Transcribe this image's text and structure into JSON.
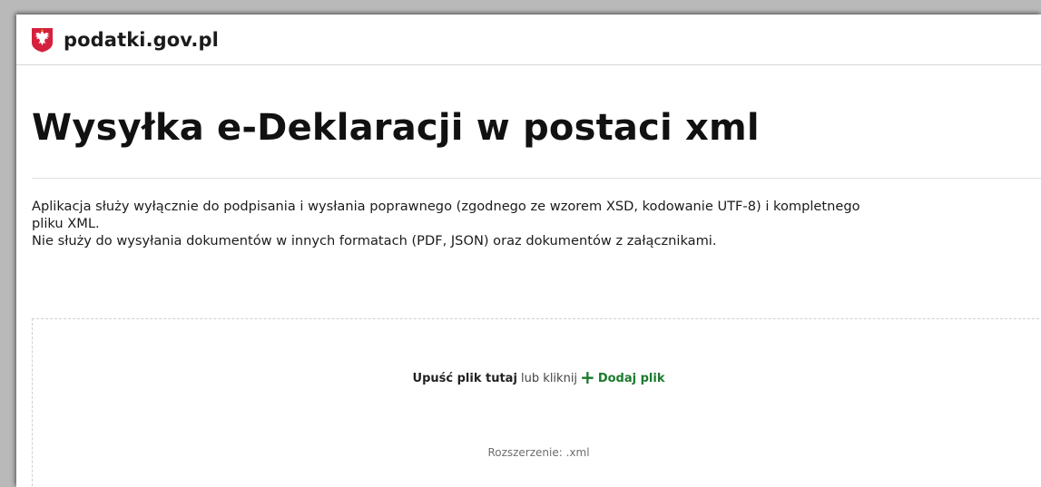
{
  "header": {
    "brand": "podatki.gov.pl",
    "logo_icon": "polish-eagle-emblem-icon",
    "brand_color": "#d4213d"
  },
  "main": {
    "title": "Wysyłka e-Deklaracji w postaci xml",
    "description_lines": [
      "Aplikacja służy wyłącznie do podpisania i wysłania poprawnego (zgodnego ze wzorem XSD, kodowanie UTF-8) i kompletnego",
      "pliku XML.",
      "Nie służy do wysyłania dokumentów w innych formatach (PDF, JSON) oraz dokumentów z załącznikami."
    ]
  },
  "dropzone": {
    "drop_text": "Upuść plik tutaj",
    "or_text": "lub",
    "click_text": "kliknij",
    "plus_icon": "plus-icon",
    "add_file_label": "Dodaj plik",
    "add_file_color": "#1b7a2e",
    "extension_text": "Rozszerzenie: .xml"
  }
}
